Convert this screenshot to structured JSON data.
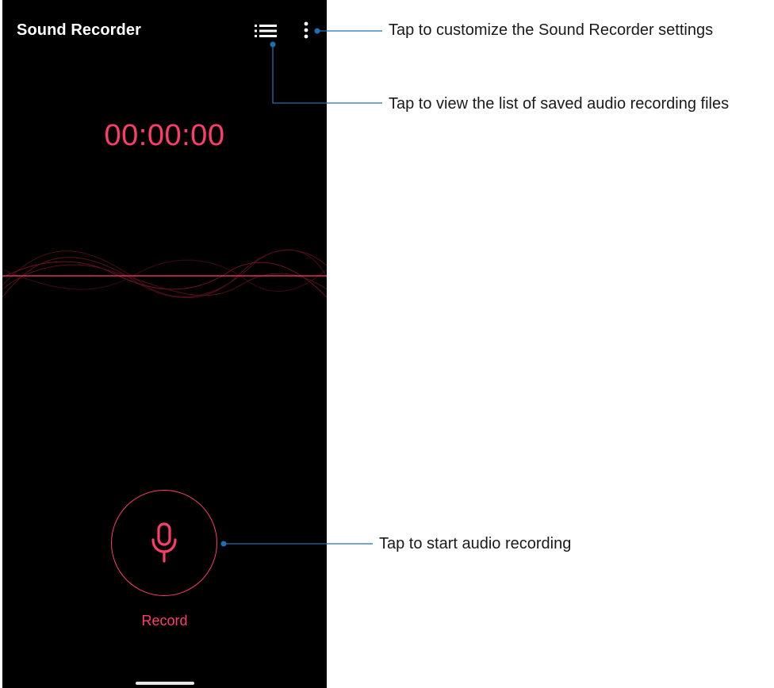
{
  "app": {
    "title": "Sound Recorder",
    "timer": "00:00:00",
    "record_label": "Record"
  },
  "icons": {
    "list": "list-icon",
    "more": "more-vertical-icon",
    "mic": "microphone-icon"
  },
  "callouts": {
    "settings": "Tap to customize the Sound Recorder settings",
    "list": "Tap to view the list of saved audio recording files",
    "record": "Tap to start audio recording"
  },
  "colors": {
    "accent": "#ff3d6a",
    "background": "#000000",
    "callout_line": "#1f6fb4"
  }
}
